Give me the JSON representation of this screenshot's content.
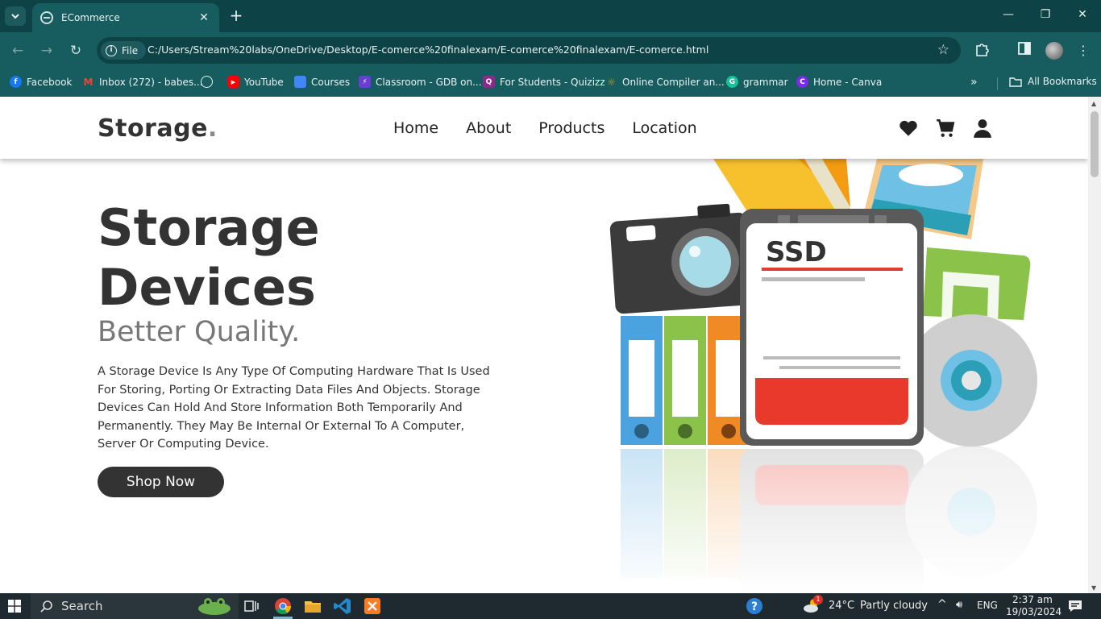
{
  "browser": {
    "tab_title": "ECommerce",
    "url_chip": "File",
    "url": "C:/Users/Stream%20labs/OneDrive/Desktop/E-comerce%20finalexam/E-comerce%20finalexam/E-comerce.html",
    "bookmarks": [
      {
        "label": "Facebook",
        "icon": "facebook-icon",
        "color": "#1877f2"
      },
      {
        "label": "Inbox (272) - babes...",
        "icon": "gmail-icon",
        "color": "#ea4335"
      },
      {
        "label": "",
        "icon": "globe-icon",
        "color": "#cfe0e0"
      },
      {
        "label": "YouTube",
        "icon": "youtube-icon",
        "color": "#ff0000"
      },
      {
        "label": "Courses",
        "icon": "classroom-icon",
        "color": "#4285f4"
      },
      {
        "label": "Classroom - GDB on...",
        "icon": "gdb-icon",
        "color": "#6a3fd0"
      },
      {
        "label": "For Students - Quizizz",
        "icon": "quizizz-icon",
        "color": "#8b2a8b"
      },
      {
        "label": "Online Compiler an...",
        "icon": "compiler-icon",
        "color": "#d88a00"
      },
      {
        "label": "grammar",
        "icon": "grammarly-icon",
        "color": "#15c39a"
      },
      {
        "label": "Home - Canva",
        "icon": "canva-icon",
        "color": "#7d2ae8"
      }
    ],
    "all_bookmarks": "All Bookmarks"
  },
  "site": {
    "logo_text": "Storage",
    "logo_dot": ".",
    "nav": [
      "Home",
      "About",
      "Products",
      "Location"
    ],
    "hero": {
      "title_line1": "Storage",
      "title_line2": "Devices",
      "subtitle": "Better Quality.",
      "description": "A Storage Device Is Any Type Of Computing Hardware That Is Used For Storing, Porting Or Extracting Data Files And Objects. Storage Devices Can Hold And Store Information Both Temporarily And Permanently. They May Be Internal Or External To A Computer, Server Or Computing Device.",
      "button": "Shop Now",
      "illustration_label": "SSD"
    }
  },
  "taskbar": {
    "search_label": "Search",
    "weather_temp": "24°C",
    "weather_desc": "Partly cloudy",
    "weather_badge": "1",
    "language": "ENG",
    "time": "2:37 am",
    "date": "19/03/2024"
  },
  "colors": {
    "chrome_dark": "#0d4346",
    "chrome_light": "#175c5f",
    "text_dark": "#333333",
    "button_bg": "#333333"
  }
}
